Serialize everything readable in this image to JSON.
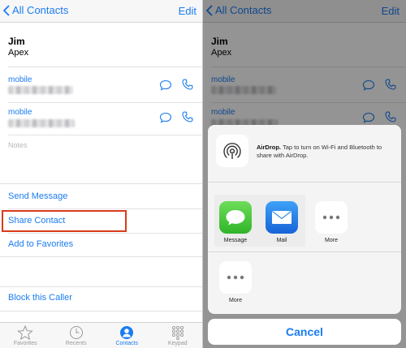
{
  "nav": {
    "back_label": "All Contacts",
    "edit_label": "Edit"
  },
  "contact": {
    "name": "Jim",
    "company": "Apex"
  },
  "phones": [
    {
      "label": "mobile"
    },
    {
      "label": "mobile"
    }
  ],
  "notes_label": "Notes",
  "actions": {
    "send_message": "Send Message",
    "share_contact": "Share Contact",
    "add_to_favorites": "Add to Favorites",
    "block_caller": "Block this Caller"
  },
  "tabs": [
    {
      "label": "Favorites",
      "icon": "star-icon",
      "active": false
    },
    {
      "label": "Recents",
      "icon": "clock-icon",
      "active": false
    },
    {
      "label": "Contacts",
      "icon": "person-icon",
      "active": true
    },
    {
      "label": "Keypad",
      "icon": "keypad-icon",
      "active": false
    }
  ],
  "share_sheet": {
    "airdrop_title": "AirDrop.",
    "airdrop_text": "Tap to turn on Wi-Fi and Bluetooth to share with AirDrop.",
    "apps": [
      {
        "label": "Message",
        "icon": "message-app-icon"
      },
      {
        "label": "Mail",
        "icon": "mail-app-icon"
      },
      {
        "label": "More",
        "icon": "more-icon"
      }
    ],
    "actions_more_label": "More",
    "cancel_label": "Cancel"
  },
  "colors": {
    "accent": "#1a7cf0",
    "highlight": "#d93b1b"
  }
}
